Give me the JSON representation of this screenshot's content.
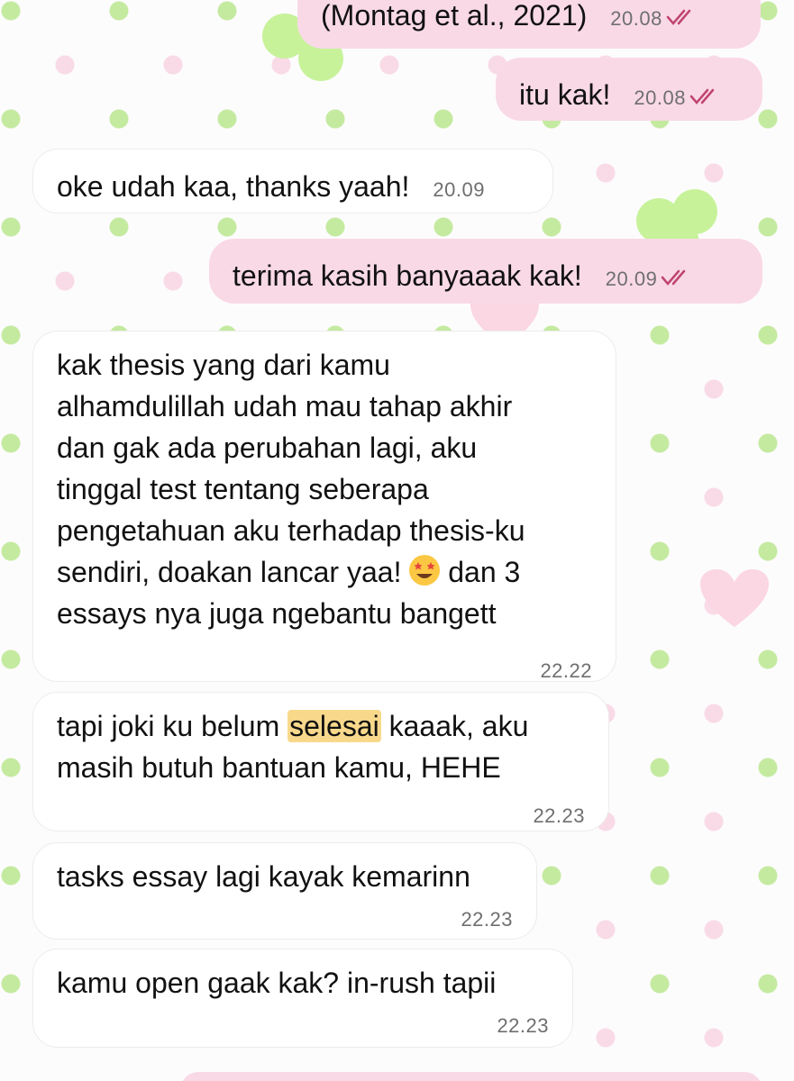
{
  "colors": {
    "outgoing_bubble": "#f9d9e6",
    "incoming_bubble": "#ffffff",
    "read_checks": "#c0446e",
    "highlight": "#f8d98c"
  },
  "messages": [
    {
      "direction": "outgoing",
      "text": "(Montag et al., 2021)",
      "time": "20.08",
      "status": "read-checks-icon"
    },
    {
      "direction": "outgoing",
      "text": "itu kak!",
      "time": "20.08",
      "status": "read-checks-icon"
    },
    {
      "direction": "incoming",
      "text": "oke udah kaa, thanks yaah!",
      "time": "20.09"
    },
    {
      "direction": "outgoing",
      "text": "terima kasih banyaaak kak!",
      "time": "20.09",
      "status": "read-checks-icon"
    },
    {
      "direction": "incoming",
      "lines": [
        "kak thesis yang dari kamu",
        "alhamdulillah udah mau tahap akhir",
        "dan gak ada perubahan lagi, aku",
        "tinggal test tentang seberapa",
        "pengetahuan aku terhadap thesis-ku",
        "sendiri, doakan lancar yaa!",
        "dan 3",
        "essays nya juga ngebantu bangett"
      ],
      "emoji": "star-struck-emoji-icon",
      "time": "22.22"
    },
    {
      "direction": "incoming",
      "parts": [
        "tapi joki ku belum ",
        "selesai",
        " kaaak, aku"
      ],
      "line2": "masih butuh bantuan kamu, HEHE",
      "time": "22.23"
    },
    {
      "direction": "incoming",
      "text": "tasks essay lagi kayak kemarinn",
      "time": "22.23"
    },
    {
      "direction": "incoming",
      "text": "kamu open gaak kak? in-rush tapii",
      "time": "22.23"
    }
  ]
}
